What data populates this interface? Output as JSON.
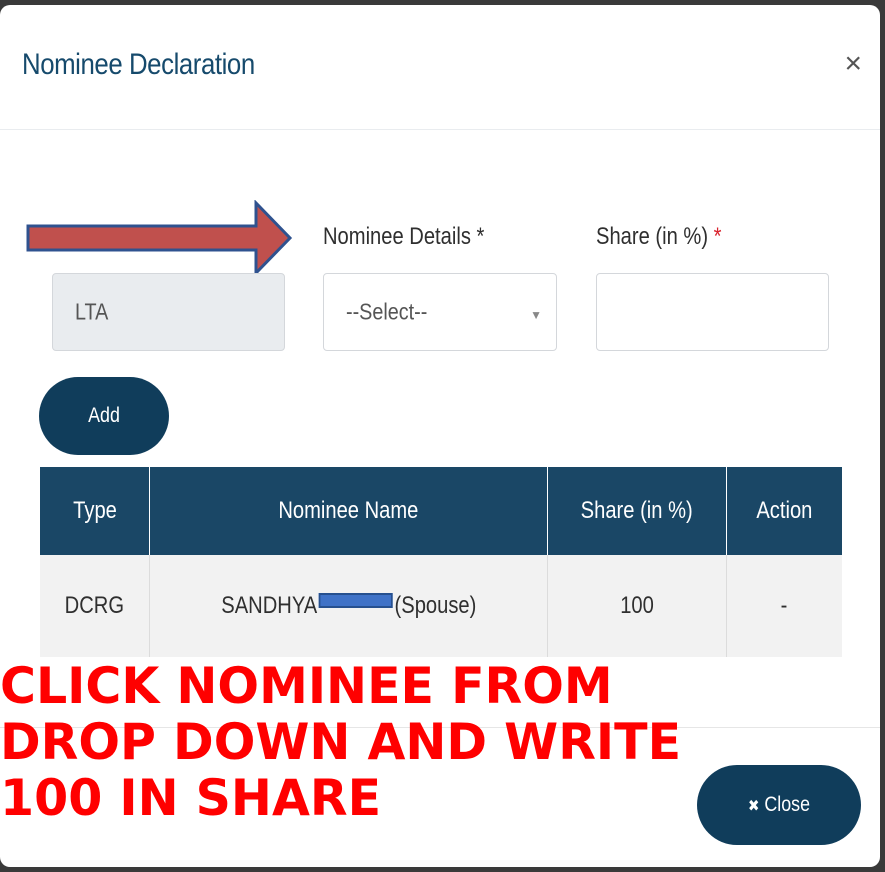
{
  "modal": {
    "title": "Nominee Declaration",
    "close_glyph": "×"
  },
  "form": {
    "type_value": "LTA",
    "nominee_label": "Nominee Details *",
    "share_label": "Share (in %)",
    "required_mark": "*",
    "nominee_select_value": "--Select--",
    "share_value": "",
    "add_label": "Add"
  },
  "table": {
    "headers": [
      "Type",
      "Nominee Name",
      "Share (in %)",
      "Action"
    ],
    "rows": [
      {
        "type": "DCRG",
        "name_first": "SANDHYA",
        "name_suffix": "(Spouse)",
        "share": "100",
        "action": "-"
      }
    ]
  },
  "instruction": {
    "line1": "CLICK NOMINEE FROM",
    "line2": "DROP DOWN AND WRITE",
    "line3": "100 IN SHARE"
  },
  "footer": {
    "close_icon": "✖",
    "close_label": "Close"
  },
  "colors": {
    "primary": "#103d5b",
    "table_header": "#1a4766",
    "required": "#d9232e",
    "annotation_red": "#ff0000",
    "arrow_fill": "#c0504d",
    "arrow_stroke": "#2f528f"
  },
  "icons": {
    "annotation": "arrow-right-icon",
    "dropdown": "caret-down-icon",
    "close": "close-icon"
  }
}
